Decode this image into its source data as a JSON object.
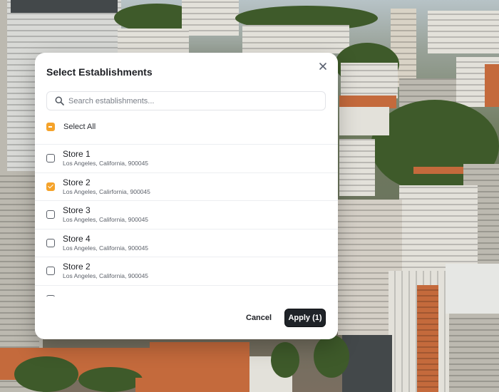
{
  "modal": {
    "title": "Select Establishments",
    "close_icon": "close-icon"
  },
  "search": {
    "placeholder": "Search establishments...",
    "value": "",
    "icon": "search-icon"
  },
  "select_all": {
    "label": "Select All",
    "state": "partial"
  },
  "establishments": [
    {
      "name": "Store 1",
      "address": "Los Angeles, California, 900045",
      "checked": false
    },
    {
      "name": "Store 2",
      "address": "Los Angeles, Calirfornia, 900045",
      "checked": true
    },
    {
      "name": "Store 3",
      "address": "Los Angeles, California, 900045",
      "checked": false
    },
    {
      "name": "Store 4",
      "address": "Los Angeles, California, 900045",
      "checked": false
    },
    {
      "name": "Store 2",
      "address": "Los Angeles, California, 900045",
      "checked": false
    },
    {
      "name": "",
      "address": "",
      "checked": false
    }
  ],
  "footer": {
    "cancel_label": "Cancel",
    "apply_label": "Apply (1)"
  },
  "colors": {
    "accent": "#f5a32a",
    "primary_button": "#1f2328"
  }
}
